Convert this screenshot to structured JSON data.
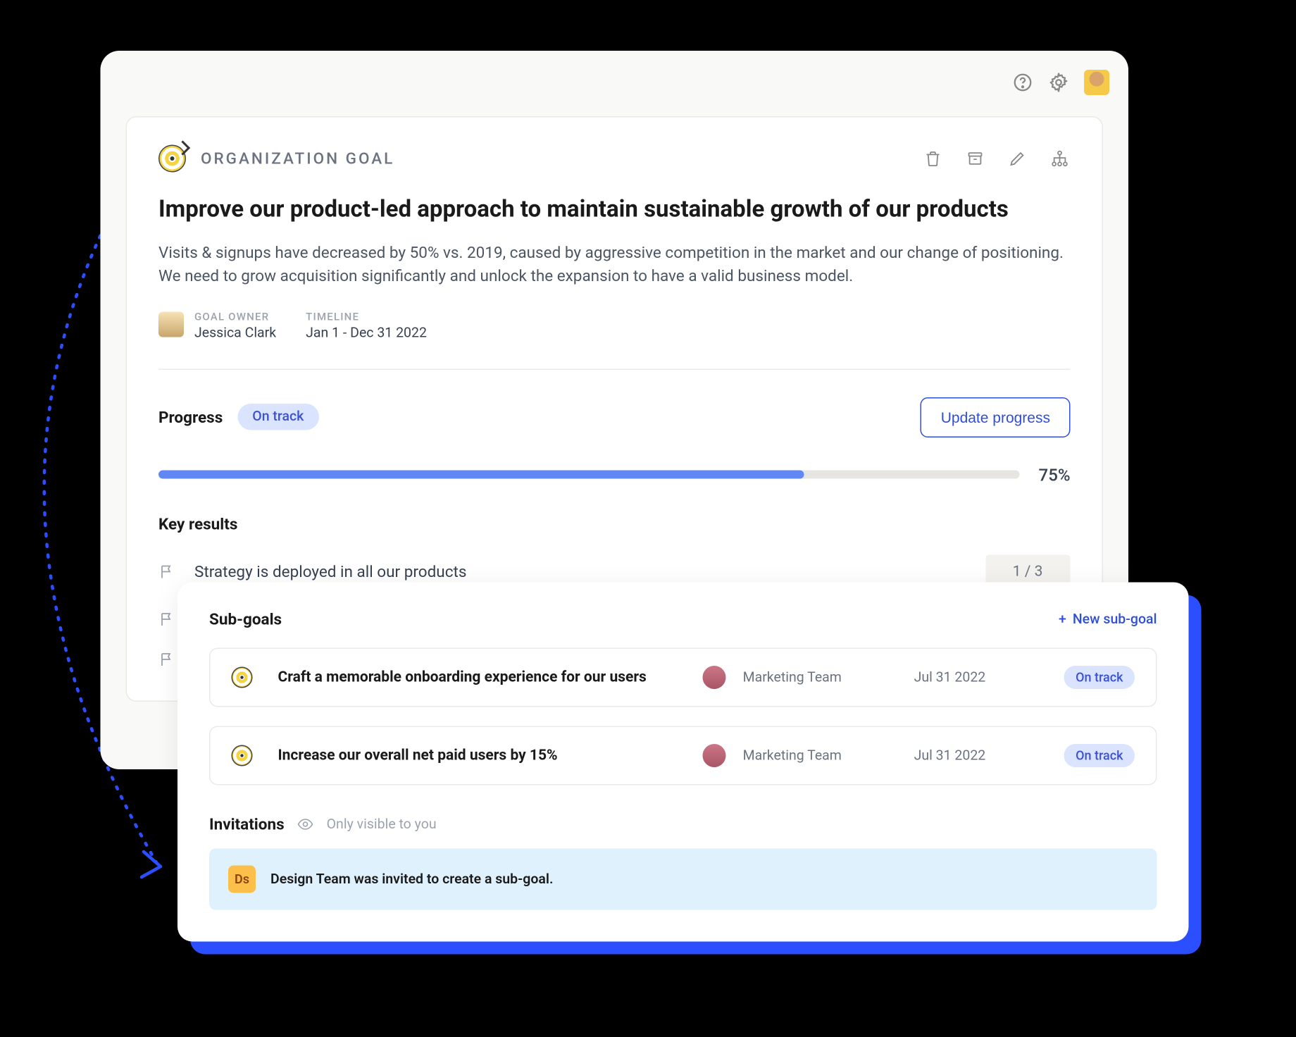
{
  "header": {
    "goalTypeLabel": "ORGANIZATION GOAL",
    "title": "Improve our product-led approach to maintain sustainable growth of our products",
    "description": "Visits & signups have decreased by 50% vs. 2019, caused by aggressive competition in the market and our change of positioning. We need to grow acquisition significantly and unlock the expansion to have a valid business model.",
    "ownerLabel": "GOAL OWNER",
    "ownerName": "Jessica Clark",
    "timelineLabel": "TIMELINE",
    "timelineValue": "Jan 1 - Dec 31 2022"
  },
  "progress": {
    "label": "Progress",
    "status": "On track",
    "updateButton": "Update progress",
    "percent": 75,
    "percentLabel": "75%"
  },
  "keyResults": {
    "heading": "Key results",
    "items": [
      {
        "text": "Strategy is deployed in all our products",
        "count": "1 / 3"
      },
      {
        "text": "",
        "count": ""
      },
      {
        "text": "",
        "count": ""
      }
    ]
  },
  "subGoals": {
    "heading": "Sub-goals",
    "newLabel": "New sub-goal",
    "items": [
      {
        "title": "Craft a memorable onboarding experience for our users",
        "team": "Marketing Team",
        "date": "Jul 31 2022",
        "status": "On track"
      },
      {
        "title": "Increase our overall net paid users by 15%",
        "team": "Marketing Team",
        "date": "Jul 31 2022",
        "status": "On track"
      }
    ]
  },
  "invitations": {
    "heading": "Invitations",
    "hint": "Only visible to you",
    "badge": "Ds",
    "text": "Design Team was invited to create a sub-goal."
  }
}
